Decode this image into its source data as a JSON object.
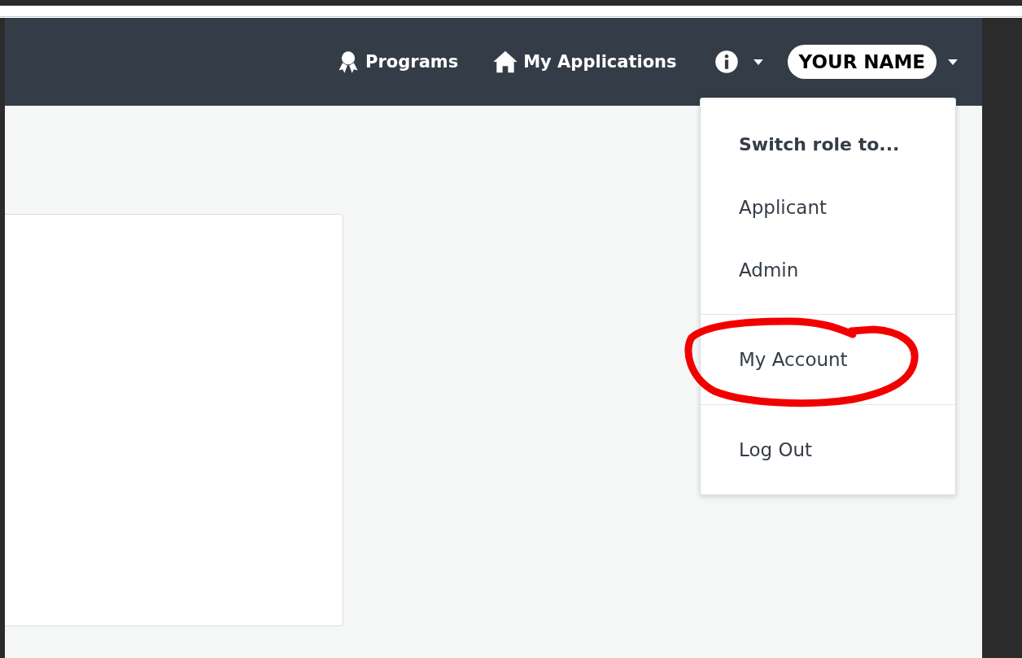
{
  "navbar": {
    "links": [
      {
        "label": "Programs"
      },
      {
        "label": "My Applications"
      }
    ],
    "user_menu": {
      "label": "YOUR NAME",
      "expanded": true,
      "sections": [
        {
          "header": "Switch role to...",
          "items": [
            {
              "label": "Applicant"
            },
            {
              "label": "Admin"
            }
          ]
        },
        {
          "items": [
            {
              "label": "My Account"
            }
          ]
        },
        {
          "items": [
            {
              "label": "Log Out"
            }
          ]
        }
      ]
    }
  }
}
